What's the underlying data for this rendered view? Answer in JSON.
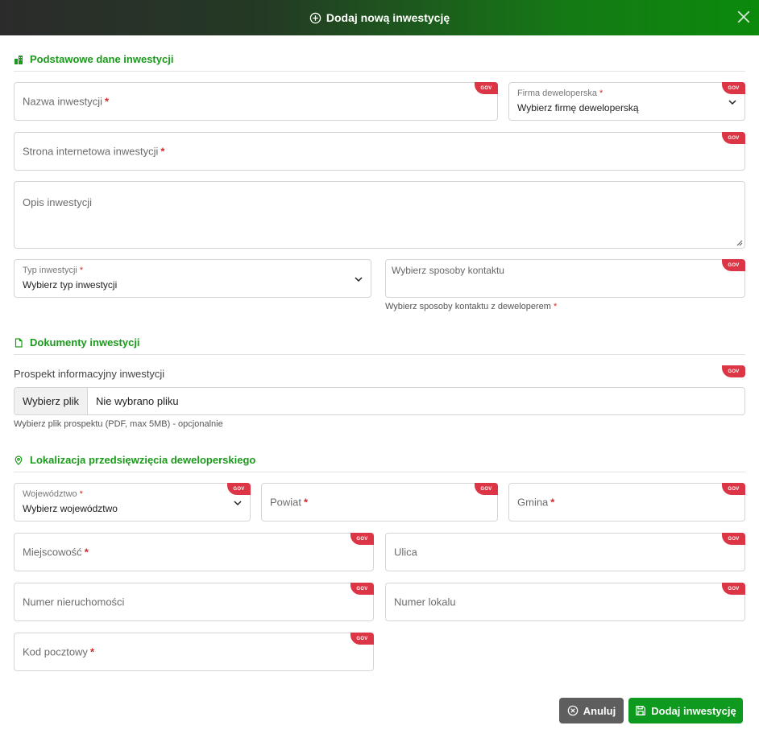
{
  "modal": {
    "title": "Dodaj nową inwestycję"
  },
  "badge": "GOV",
  "sections": {
    "basic": "Podstawowe dane inwestycji",
    "documents": "Dokumenty inwestycji",
    "location": "Lokalizacja przedsięwzięcia deweloperskiego"
  },
  "basic": {
    "name": {
      "label": "Nazwa inwestycji"
    },
    "developer": {
      "label": "Firma deweloperska",
      "value": "Wybierz firmę deweloperską"
    },
    "website": {
      "label": "Strona internetowa inwestycji"
    },
    "description": {
      "label": "Opis inwestycji"
    },
    "type": {
      "label": "Typ inwestycji",
      "value": "Wybierz typ inwestycji"
    },
    "contact": {
      "label": "Wybierz sposoby kontaktu",
      "help": "Wybierz sposoby kontaktu z deweloperem"
    }
  },
  "documents": {
    "prospectus_label": "Prospekt informacyjny inwestycji",
    "choose_file": "Wybierz plik",
    "no_file": "Nie wybrano pliku",
    "help": "Wybierz plik prospektu (PDF, max 5MB) - opcjonalnie"
  },
  "location": {
    "voivodeship": {
      "label": "Województwo",
      "value": "Wybierz województwo"
    },
    "county": {
      "label": "Powiat"
    },
    "commune": {
      "label": "Gmina"
    },
    "city": {
      "label": "Miejscowość"
    },
    "street": {
      "label": "Ulica"
    },
    "property_number": {
      "label": "Numer nieruchomości"
    },
    "unit_number": {
      "label": "Numer lokalu"
    },
    "postal_code": {
      "label": "Kod pocztowy"
    }
  },
  "required_mark": "*",
  "buttons": {
    "cancel": "Anuluj",
    "submit": "Dodaj inwestycję"
  }
}
